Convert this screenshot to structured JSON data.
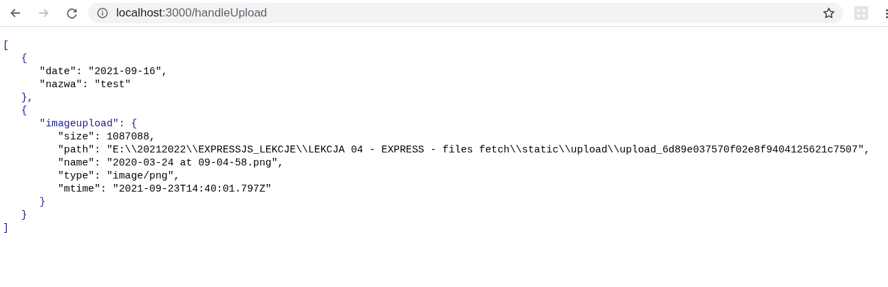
{
  "toolbar": {
    "back": {
      "disabled": false
    },
    "forward": {
      "disabled": true
    },
    "address": {
      "host": "localhost",
      "path": ":3000/handleUpload"
    }
  },
  "code": [
    {
      "open": "[",
      "close": "]",
      "children": [
        {
          "open": "{",
          "close": "},",
          "children": [
            {
              "text": "\"date\": \"2021-09-16\","
            },
            {
              "text": "\"nazwa\": \"test\""
            }
          ]
        },
        {
          "open": "{",
          "close": "}",
          "children": [
            {
              "open": "\"imageupload\": {",
              "close": "}",
              "children": [
                {
                  "text": "\"size\": 1087088,"
                },
                {
                  "text": "\"path\": \"E:\\\\20212022\\\\EXPRESSJS_LEKCJE\\\\LEKCJA 04 - EXPRESS - files fetch\\\\static\\\\upload\\\\upload_6d89e037570f02e8f9404125621c7507\","
                },
                {
                  "text": "\"name\": \"2020-03-24 at 09-04-58.png\","
                },
                {
                  "text": "\"type\": \"image/png\","
                },
                {
                  "text": "\"mtime\": \"2021-09-23T14:40:01.797Z\""
                }
              ]
            }
          ]
        }
      ]
    }
  ]
}
